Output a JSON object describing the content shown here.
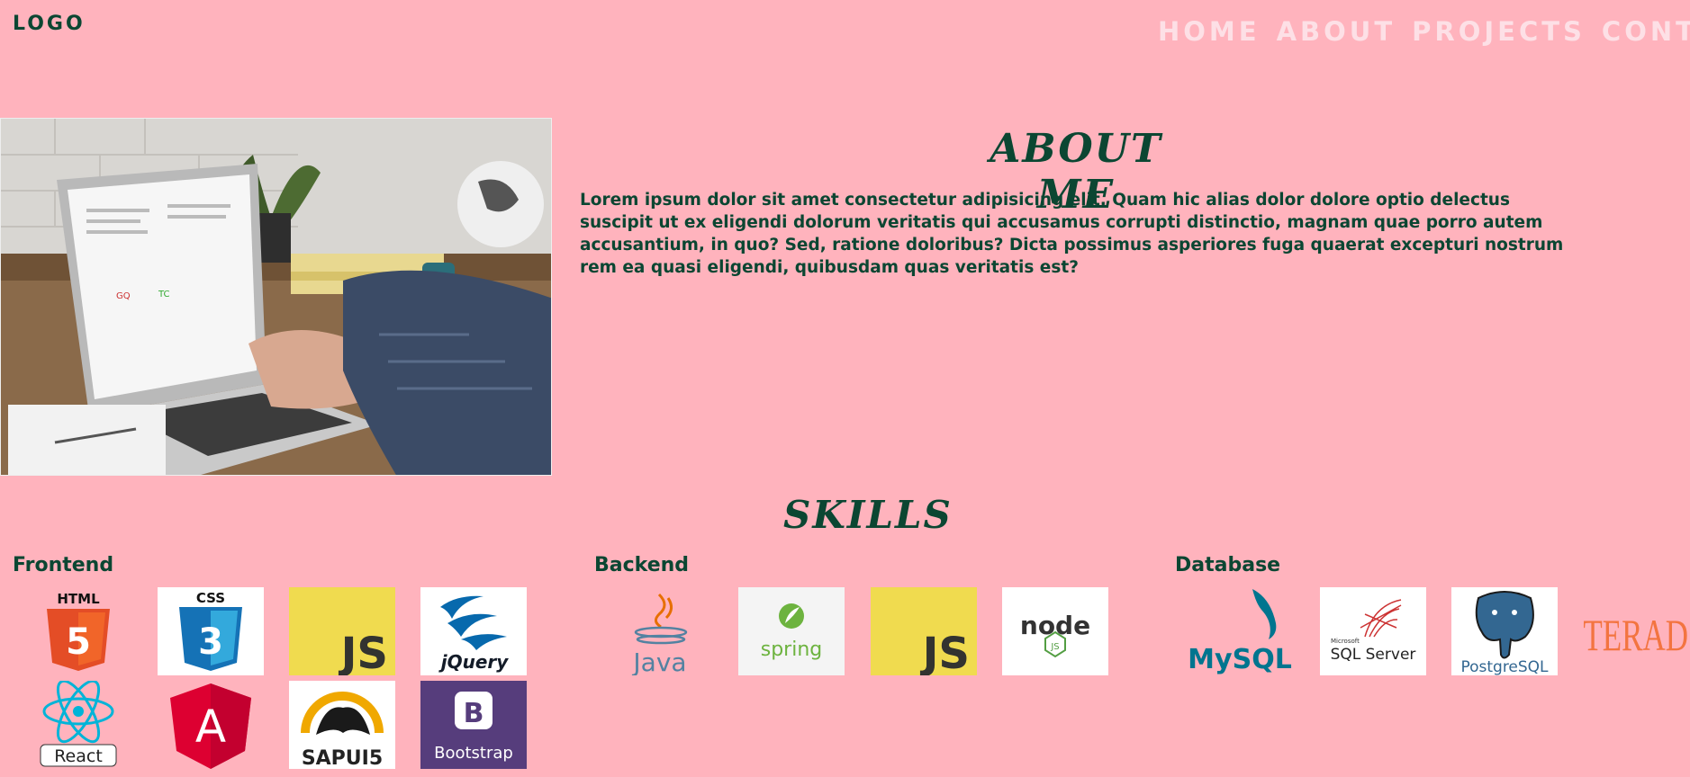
{
  "header": {
    "logo": "LOGO",
    "nav": [
      "HOME",
      "ABOUT",
      "PROJECTS",
      "CONTACT"
    ]
  },
  "about": {
    "title": "ABOUT ME",
    "text": "Lorem ipsum dolor sit amet consectetur adipisicing elit. Quam hic alias dolor dolore optio delectus suscipit ut ex eligendi dolorum veritatis qui accusamus corrupti distinctio, magnam quae porro autem accusantium, in quo? Sed, ratione doloribus? Dicta possimus asperiores fuga quaerat excepturi nostrum rem ea quasi eligendi, quibusdam quas veritatis est?"
  },
  "skills": {
    "title": "SKILLS",
    "categories": [
      {
        "name": "Frontend",
        "logos": [
          "HTML",
          "CSS",
          "JS",
          "jQuery",
          "React",
          "A",
          "SAPUI5",
          "B",
          "Bootstrap"
        ]
      },
      {
        "name": "Backend",
        "logos": [
          "Java",
          "spring",
          "JS",
          "node",
          "JS"
        ]
      },
      {
        "name": "Database",
        "logos": [
          "MySQL",
          "Microsoft",
          "SQL Server",
          "PostgreSQL",
          "TERADATA"
        ]
      }
    ]
  },
  "colors": {
    "background": "#ffb3bd",
    "text": "#0b4632",
    "nav": "#fde0e6"
  }
}
